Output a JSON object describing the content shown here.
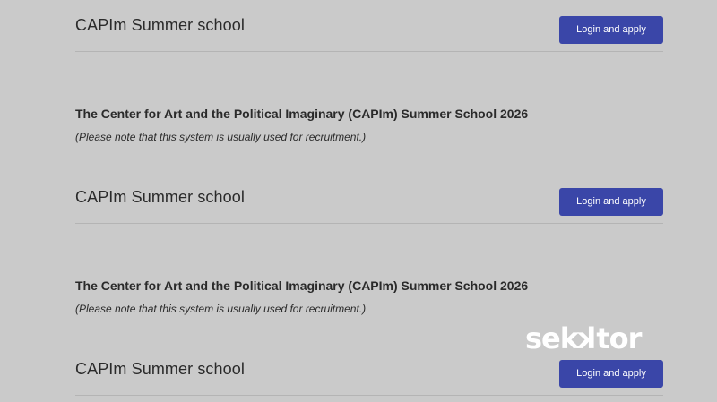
{
  "sections": [
    {
      "title": "CAPIm Summer school",
      "button_label": "Login and apply"
    },
    {
      "title": "CAPIm Summer school",
      "button_label": "Login and apply"
    },
    {
      "title": "CAPIm Summer school",
      "button_label": "Login and apply"
    }
  ],
  "programs": [
    {
      "title": "The Center for Art and the Political Imaginary (CAPIm) Summer School 2026",
      "note": "(Please note that this system is usually used for recruitment.)"
    },
    {
      "title": "The Center for Art and the Political Imaginary (CAPIm) Summer School 2026",
      "note": "(Please note that this system is usually used for recruitment.)"
    }
  ],
  "watermark": {
    "part1": "sek",
    "part2": "k",
    "part3": "tor",
    "color": "#ffffff"
  },
  "colors": {
    "background": "#cacaca",
    "button": "#3a46a8",
    "text": "#2a2a2a"
  }
}
